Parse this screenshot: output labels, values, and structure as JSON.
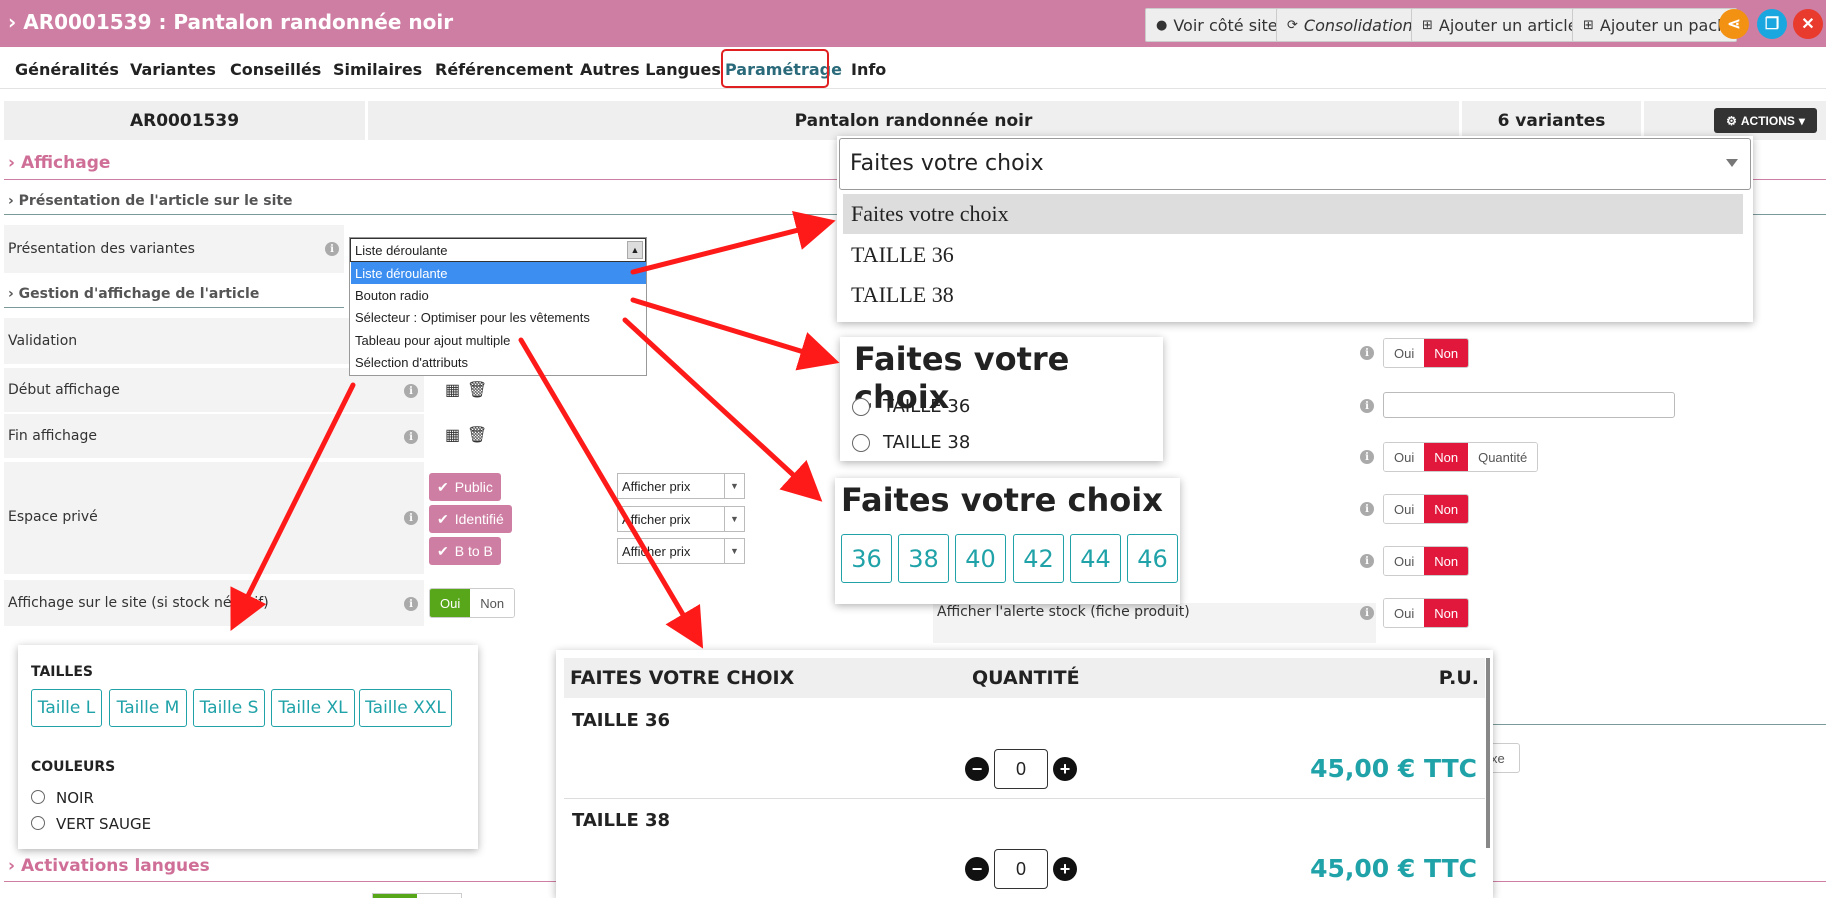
{
  "header": {
    "title": "AR0001539 : Pantalon randonnée noir",
    "buttons": {
      "voir_site": "Voir côté site",
      "consolidation": "Consolidation",
      "ajouter_article": "Ajouter un article",
      "ajouter_pack": "Ajouter un pack"
    }
  },
  "tabs": [
    "Généralités",
    "Variantes",
    "Conseillés",
    "Similaires",
    "Référencement",
    "Autres Langues",
    "Paramétrage",
    "Info"
  ],
  "summary": {
    "reference": "AR0001539",
    "name": "Pantalon randonnée noir",
    "variants": "6 variantes",
    "actions": "ACTIONS"
  },
  "sections": {
    "affichage": "Affichage",
    "presentation": "Présentation de l'article sur le site",
    "gestion": "Gestion d'affichage de l'article",
    "activations": "Activations langues"
  },
  "form": {
    "presentation_variantes": "Présentation des variantes",
    "validation": "Validation",
    "debut_affichage": "Début affichage",
    "fin_affichage": "Fin affichage",
    "espace_prive": "Espace privé",
    "affichage_stock": "Affichage sur le site (si stock négatif)",
    "alerte_stock": "Afficher l'alerte stock (fiche produit)"
  },
  "listbox": {
    "selected": "Liste déroulante",
    "options": [
      "Liste déroulante",
      "Bouton radio",
      "Sélecteur : Optimiser pour les vêtements",
      "Tableau pour ajout multiple",
      "Sélection d'attributs"
    ]
  },
  "espace_prive": {
    "badges": [
      "Public",
      "Identifié",
      "B to B"
    ],
    "select_value": "Afficher prix"
  },
  "toggles": {
    "oui": "Oui",
    "non": "Non",
    "quantite": "Quantité",
    "partial_label": "xe"
  },
  "dropdown_demo": {
    "placeholder": "Faites votre choix",
    "options": [
      "Faites votre choix",
      "TAILLE 36",
      "TAILLE 38"
    ]
  },
  "radio_demo": {
    "title": "Faites votre choix",
    "options": [
      "TAILLE 36",
      "TAILLE 38"
    ]
  },
  "buttons_demo": {
    "title": "Faites votre choix",
    "sizes": [
      "36",
      "38",
      "40",
      "42",
      "44",
      "46"
    ]
  },
  "attributes_demo": {
    "tailles_label": "TAILLES",
    "tailles": [
      "Taille L",
      "Taille M",
      "Taille S",
      "Taille XL",
      "Taille XXL"
    ],
    "couleurs_label": "COULEURS",
    "couleurs": [
      "NOIR",
      "VERT SAUGE"
    ]
  },
  "table_demo": {
    "headers": [
      "FAITES VOTRE CHOIX",
      "QUANTITÉ",
      "P.U."
    ],
    "rows": [
      {
        "name": "TAILLE 36",
        "qty": "0",
        "price": "45,00 € TTC"
      },
      {
        "name": "TAILLE 38",
        "qty": "0",
        "price": "45,00 € TTC"
      }
    ]
  },
  "colors": {
    "brand_pink": "#cf7ea3",
    "accent_teal": "#1fa2a8",
    "red_active": "#e2173c",
    "green_active": "#58a61a",
    "annotation_red": "#ff1a1a"
  }
}
